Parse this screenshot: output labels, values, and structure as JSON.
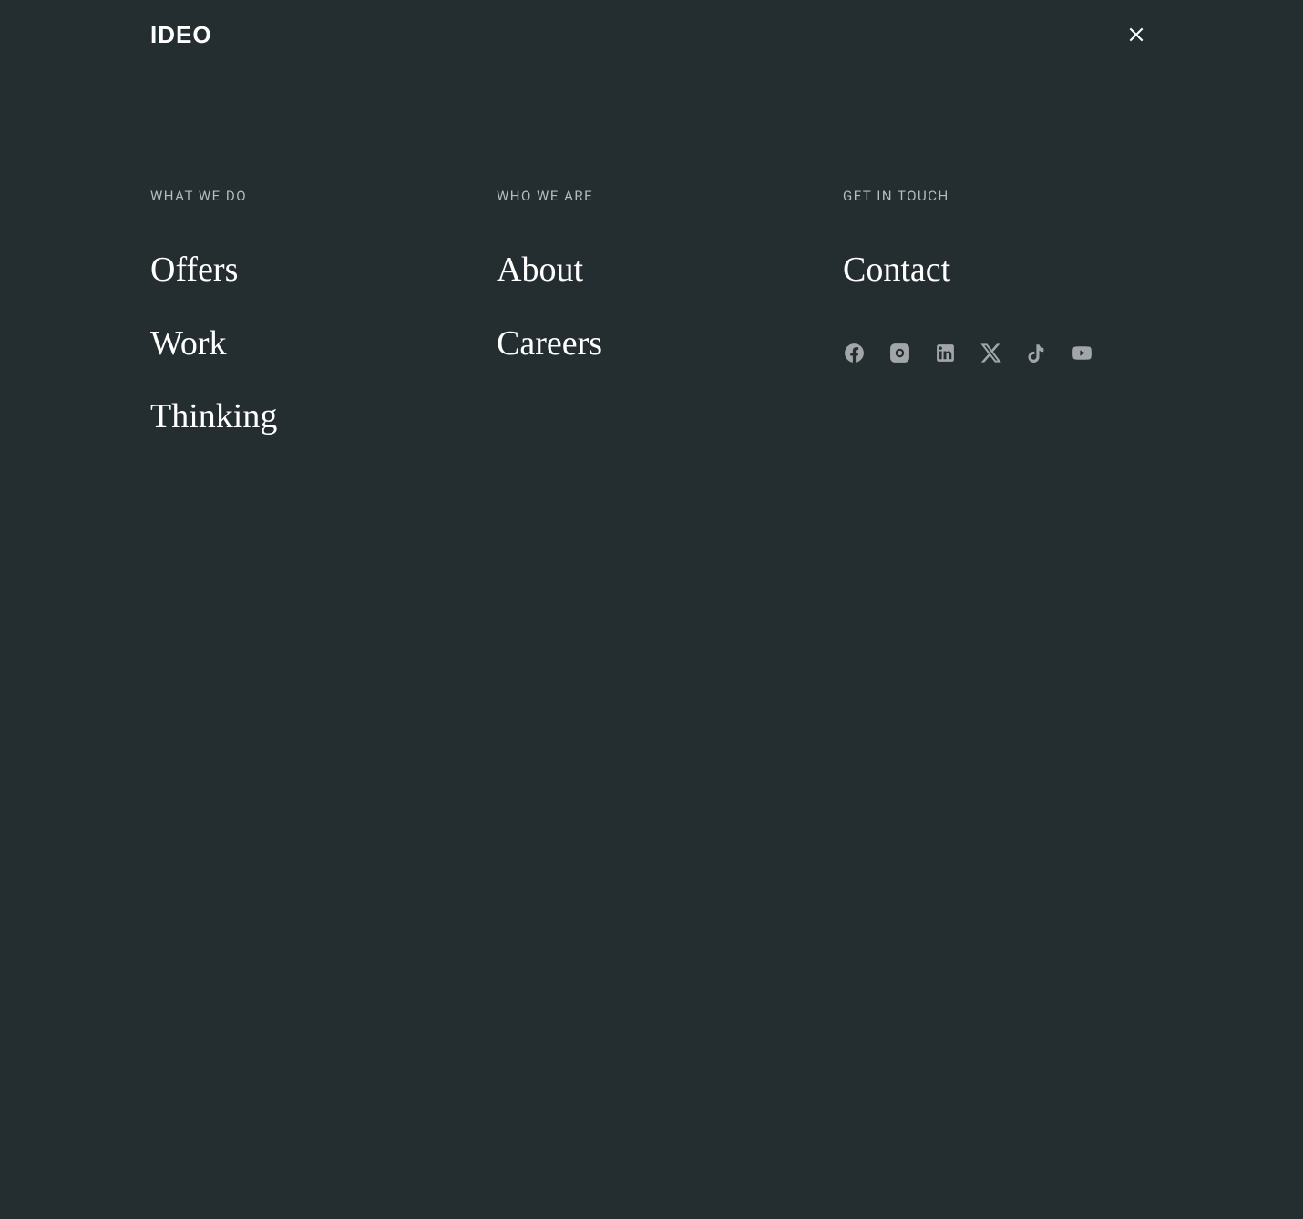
{
  "brand": "IDEO",
  "columns": {
    "col1": {
      "heading": "WHAT WE DO",
      "links": {
        "offers": "Offers",
        "work": "Work",
        "thinking": "Thinking"
      }
    },
    "col2": {
      "heading": "WHO WE ARE",
      "links": {
        "about": "About",
        "careers": "Careers"
      }
    },
    "col3": {
      "heading": "GET IN TOUCH",
      "links": {
        "contact": "Contact"
      }
    }
  },
  "social": {
    "facebook": "facebook",
    "instagram": "instagram",
    "linkedin": "linkedin",
    "x": "x",
    "tiktok": "tiktok",
    "youtube": "youtube"
  }
}
